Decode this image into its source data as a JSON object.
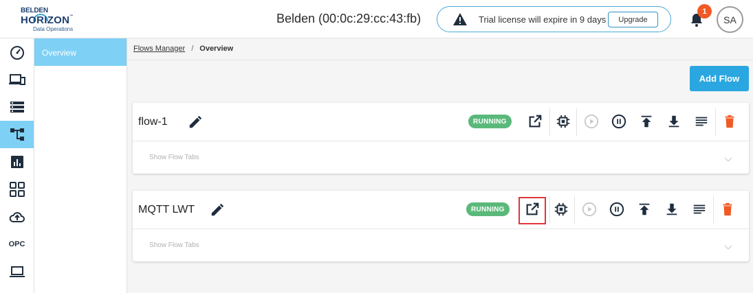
{
  "logo": {
    "line1": "BELDEN",
    "line2": "HORIZON",
    "tm": "™",
    "line3": "Data Operations"
  },
  "header": {
    "device_title": "Belden (00:0c:29:cc:43:fb)",
    "trial_text": "Trial license will expire in 9 days",
    "upgrade_label": "Upgrade",
    "notification_count": "1",
    "avatar_initials": "SA"
  },
  "rail": {
    "opc_label": "OPC"
  },
  "sidebar": {
    "items": [
      {
        "label": "Overview"
      }
    ]
  },
  "breadcrumb": {
    "parent": "Flows Manager",
    "separator": "/",
    "current": "Overview"
  },
  "actions": {
    "add_flow_label": "Add Flow"
  },
  "flows": [
    {
      "name": "flow-1",
      "status": "RUNNING",
      "tabs_label": "Show Flow Tabs"
    },
    {
      "name": "MQTT LWT",
      "status": "RUNNING",
      "tabs_label": "Show Flow Tabs"
    }
  ],
  "colors": {
    "accent": "#2aa7e0",
    "sidebar_active": "#7fd0f5",
    "running": "#5ab97a",
    "delete": "#f15a24",
    "highlight": "#e0343a"
  }
}
